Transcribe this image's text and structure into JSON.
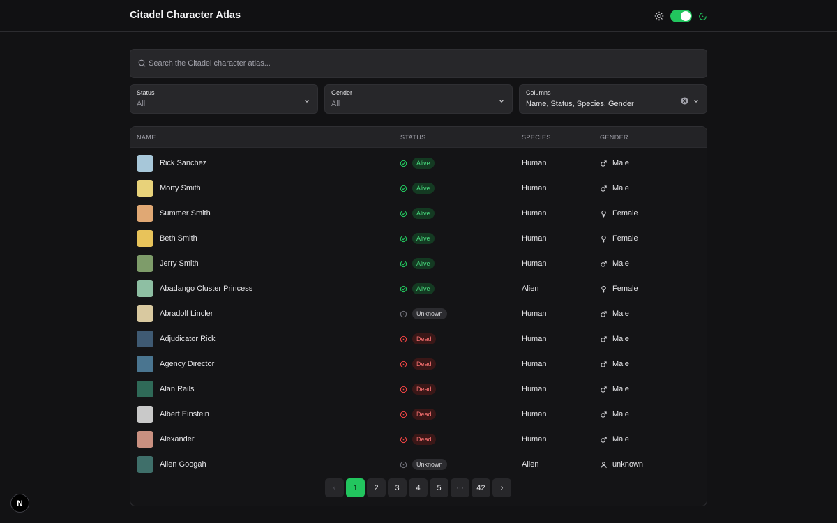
{
  "app": {
    "title": "Citadel Character Atlas"
  },
  "theme": {
    "dark_mode": true,
    "accent": "#22c55e"
  },
  "search": {
    "placeholder": "Search the Citadel character atlas...",
    "value": ""
  },
  "filters": {
    "status": {
      "label": "Status",
      "value": "All"
    },
    "gender": {
      "label": "Gender",
      "value": "All"
    },
    "columns": {
      "label": "Columns",
      "value": "Name, Status, Species, Gender"
    }
  },
  "table": {
    "headers": [
      "NAME",
      "STATUS",
      "SPECIES",
      "GENDER"
    ],
    "rows": [
      {
        "name": "Rick Sanchez",
        "status": "Alive",
        "species": "Human",
        "gender": "Male"
      },
      {
        "name": "Morty Smith",
        "status": "Alive",
        "species": "Human",
        "gender": "Male"
      },
      {
        "name": "Summer Smith",
        "status": "Alive",
        "species": "Human",
        "gender": "Female"
      },
      {
        "name": "Beth Smith",
        "status": "Alive",
        "species": "Human",
        "gender": "Female"
      },
      {
        "name": "Jerry Smith",
        "status": "Alive",
        "species": "Human",
        "gender": "Male"
      },
      {
        "name": "Abadango Cluster Princess",
        "status": "Alive",
        "species": "Alien",
        "gender": "Female"
      },
      {
        "name": "Abradolf Lincler",
        "status": "Unknown",
        "species": "Human",
        "gender": "Male"
      },
      {
        "name": "Adjudicator Rick",
        "status": "Dead",
        "species": "Human",
        "gender": "Male"
      },
      {
        "name": "Agency Director",
        "status": "Dead",
        "species": "Human",
        "gender": "Male"
      },
      {
        "name": "Alan Rails",
        "status": "Dead",
        "species": "Human",
        "gender": "Male"
      },
      {
        "name": "Albert Einstein",
        "status": "Dead",
        "species": "Human",
        "gender": "Male"
      },
      {
        "name": "Alexander",
        "status": "Dead",
        "species": "Human",
        "gender": "Male"
      },
      {
        "name": "Alien Googah",
        "status": "Unknown",
        "species": "Alien",
        "gender": "unknown"
      }
    ]
  },
  "pagination": {
    "prev": "‹",
    "next": "›",
    "pages": [
      "1",
      "2",
      "3",
      "4",
      "5",
      "···",
      "42"
    ],
    "current": "1"
  },
  "corner_badge": "N"
}
